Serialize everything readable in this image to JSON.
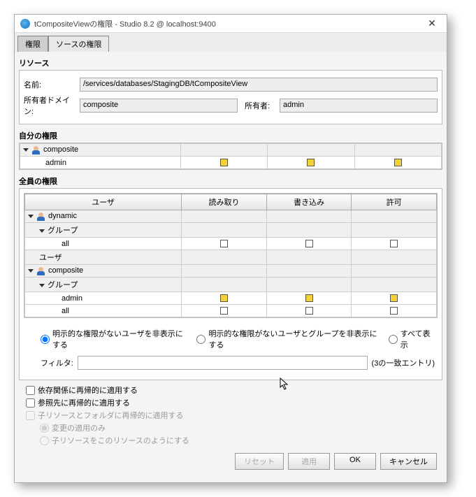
{
  "window": {
    "title": "tCompositeViewの権限 - Studio 8.2 @ localhost:9400"
  },
  "tabs": {
    "privileges": "権限",
    "source": "ソースの権限"
  },
  "resource": {
    "section": "リソース",
    "name_label": "名前:",
    "name_value": "/services/databases/StagingDB/tCompositeView",
    "owner_domain_label": "所有者ドメイン:",
    "owner_domain_value": "composite",
    "owner_label": "所有者:",
    "owner_value": "admin"
  },
  "own": {
    "section": "自分の権限",
    "group": "composite",
    "user": "admin",
    "cols": {
      "col2": "",
      "col3": "",
      "col4": ""
    }
  },
  "all": {
    "section": "全員の権限",
    "headers": {
      "user": "ユーザ",
      "read": "読み取り",
      "write": "書き込み",
      "grant": "許可"
    },
    "rows": {
      "dynamic": "dynamic",
      "group_label": "グループ",
      "all": "all",
      "user_label": "ユーザ",
      "composite": "composite",
      "admin": "admin"
    }
  },
  "display": {
    "opt1": "明示的な権限がないユーザを非表示にする",
    "opt2": "明示的な権限がないユーザとグループを非表示にする",
    "opt3": "すべて表示"
  },
  "filter": {
    "label": "フィルタ:",
    "count": "(3の一致エントリ)"
  },
  "recurse": {
    "deps": "依存関係に再帰的に適用する",
    "refs": "参照先に再帰的に適用する",
    "children": "子リソースとフォルダに再帰的に適用する",
    "changes_only": "変更の適用のみ",
    "as_this": "子リソースをこのリソースのようにする"
  },
  "buttons": {
    "reset": "リセット",
    "apply": "適用",
    "ok": "OK",
    "cancel": "キャンセル"
  }
}
